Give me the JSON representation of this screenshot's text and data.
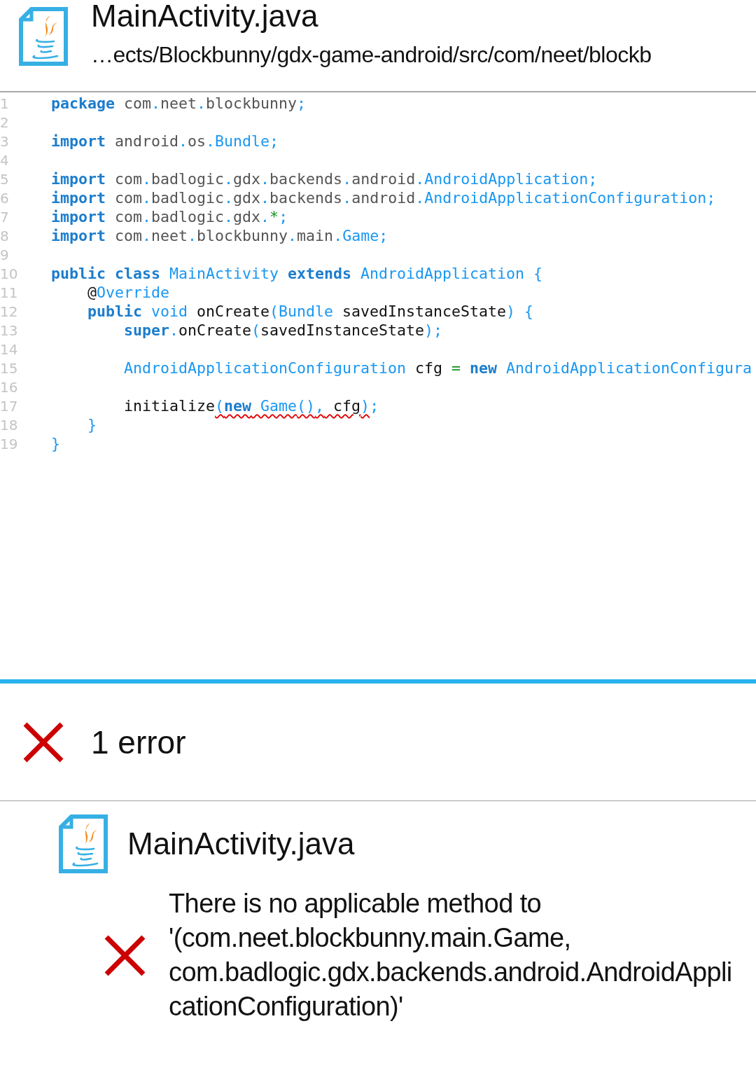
{
  "header": {
    "file_name": "MainActivity.java",
    "path": "…ects/Blockbunny/gdx-game-android/src/com/neet/blockb"
  },
  "editor": {
    "lines": [
      {
        "number": "1",
        "tokens": [
          {
            "text": "package",
            "kind": "keyword"
          },
          {
            "text": " com",
            "kind": "path"
          },
          {
            "text": ".",
            "kind": "punct"
          },
          {
            "text": "neet",
            "kind": "path"
          },
          {
            "text": ".",
            "kind": "punct"
          },
          {
            "text": "blockbunny",
            "kind": "path"
          },
          {
            "text": ";",
            "kind": "punct"
          }
        ]
      },
      {
        "number": "2"
      },
      {
        "number": "3",
        "tokens": [
          {
            "text": "import",
            "kind": "keyword"
          },
          {
            "text": " android",
            "kind": "path"
          },
          {
            "text": ".",
            "kind": "punct"
          },
          {
            "text": "os",
            "kind": "path"
          },
          {
            "text": ".",
            "kind": "punct"
          },
          {
            "text": "Bundle",
            "kind": "type"
          },
          {
            "text": ";",
            "kind": "punct"
          }
        ]
      },
      {
        "number": "4"
      },
      {
        "number": "5",
        "tokens": [
          {
            "text": "import",
            "kind": "keyword"
          },
          {
            "text": " com",
            "kind": "path"
          },
          {
            "text": ".",
            "kind": "punct"
          },
          {
            "text": "badlogic",
            "kind": "path"
          },
          {
            "text": ".",
            "kind": "punct"
          },
          {
            "text": "gdx",
            "kind": "path"
          },
          {
            "text": ".",
            "kind": "punct"
          },
          {
            "text": "backends",
            "kind": "path"
          },
          {
            "text": ".",
            "kind": "punct"
          },
          {
            "text": "android",
            "kind": "path"
          },
          {
            "text": ".",
            "kind": "punct"
          },
          {
            "text": "AndroidApplication",
            "kind": "type"
          },
          {
            "text": ";",
            "kind": "punct"
          }
        ]
      },
      {
        "number": "6",
        "tokens": [
          {
            "text": "import",
            "kind": "keyword"
          },
          {
            "text": " com",
            "kind": "path"
          },
          {
            "text": ".",
            "kind": "punct"
          },
          {
            "text": "badlogic",
            "kind": "path"
          },
          {
            "text": ".",
            "kind": "punct"
          },
          {
            "text": "gdx",
            "kind": "path"
          },
          {
            "text": ".",
            "kind": "punct"
          },
          {
            "text": "backends",
            "kind": "path"
          },
          {
            "text": ".",
            "kind": "punct"
          },
          {
            "text": "android",
            "kind": "path"
          },
          {
            "text": ".",
            "kind": "punct"
          },
          {
            "text": "AndroidApplicationConfiguration",
            "kind": "type"
          },
          {
            "text": ";",
            "kind": "punct"
          }
        ]
      },
      {
        "number": "7",
        "tokens": [
          {
            "text": "import",
            "kind": "keyword"
          },
          {
            "text": " com",
            "kind": "path"
          },
          {
            "text": ".",
            "kind": "punct"
          },
          {
            "text": "badlogic",
            "kind": "path"
          },
          {
            "text": ".",
            "kind": "punct"
          },
          {
            "text": "gdx",
            "kind": "path"
          },
          {
            "text": ".",
            "kind": "punct"
          },
          {
            "text": "*",
            "kind": "operator"
          },
          {
            "text": ";",
            "kind": "punct"
          }
        ]
      },
      {
        "number": "8",
        "tokens": [
          {
            "text": "import",
            "kind": "keyword"
          },
          {
            "text": " com",
            "kind": "path"
          },
          {
            "text": ".",
            "kind": "punct"
          },
          {
            "text": "neet",
            "kind": "path"
          },
          {
            "text": ".",
            "kind": "punct"
          },
          {
            "text": "blockbunny",
            "kind": "path"
          },
          {
            "text": ".",
            "kind": "punct"
          },
          {
            "text": "main",
            "kind": "path"
          },
          {
            "text": ".",
            "kind": "punct"
          },
          {
            "text": "Game",
            "kind": "type"
          },
          {
            "text": ";",
            "kind": "punct"
          }
        ]
      },
      {
        "number": "9"
      },
      {
        "number": "10",
        "tokens": [
          {
            "text": "public",
            "kind": "keyword"
          },
          {
            "text": " class",
            "kind": "keyword"
          },
          {
            "text": " MainActivity",
            "kind": "type"
          },
          {
            "text": " extends",
            "kind": "keyword"
          },
          {
            "text": " AndroidApplication",
            "kind": "type"
          },
          {
            "text": " {",
            "kind": "punct"
          }
        ]
      },
      {
        "number": "11",
        "tokens": [
          {
            "text": "    @",
            "kind": "name"
          },
          {
            "text": "Override",
            "kind": "type"
          }
        ]
      },
      {
        "number": "12",
        "tokens": [
          {
            "text": "    public",
            "kind": "keyword"
          },
          {
            "text": " void",
            "kind": "type"
          },
          {
            "text": " onCreate",
            "kind": "name"
          },
          {
            "text": "(",
            "kind": "punct"
          },
          {
            "text": "Bundle",
            "kind": "type"
          },
          {
            "text": " savedInstanceState",
            "kind": "name"
          },
          {
            "text": ")",
            "kind": "punct"
          },
          {
            "text": " {",
            "kind": "punct"
          }
        ]
      },
      {
        "number": "13",
        "tokens": [
          {
            "text": "        super",
            "kind": "keyword"
          },
          {
            "text": ".",
            "kind": "punct"
          },
          {
            "text": "onCreate",
            "kind": "name"
          },
          {
            "text": "(",
            "kind": "punct"
          },
          {
            "text": "savedInstanceState",
            "kind": "name"
          },
          {
            "text": ");",
            "kind": "punct"
          }
        ]
      },
      {
        "number": "14"
      },
      {
        "number": "15",
        "tokens": [
          {
            "text": "        AndroidApplicationConfiguration",
            "kind": "type"
          },
          {
            "text": " cfg",
            "kind": "name"
          },
          {
            "text": " =",
            "kind": "operator"
          },
          {
            "text": " new",
            "kind": "keyword"
          },
          {
            "text": " AndroidApplicationConfigura",
            "kind": "type"
          }
        ]
      },
      {
        "number": "16"
      },
      {
        "number": "17",
        "tokens": [
          {
            "text": "        initialize",
            "kind": "name"
          },
          {
            "kind": "error_span",
            "tokens": [
              {
                "text": "(",
                "kind": "punct"
              },
              {
                "text": "new",
                "kind": "keyword"
              },
              {
                "text": " Game",
                "kind": "type"
              },
              {
                "text": "()",
                "kind": "punct"
              },
              {
                "text": ",",
                "kind": "punct"
              },
              {
                "text": " cfg",
                "kind": "name"
              },
              {
                "text": ")",
                "kind": "punct"
              }
            ]
          },
          {
            "text": ";",
            "kind": "punct"
          }
        ]
      },
      {
        "number": "18",
        "tokens": [
          {
            "text": "    }",
            "kind": "punct"
          }
        ]
      },
      {
        "number": "19",
        "tokens": [
          {
            "text": "}",
            "kind": "punct"
          }
        ]
      }
    ]
  },
  "problems": {
    "summary": {
      "kind": "error",
      "text": "1 error"
    },
    "files": [
      {
        "file_name": "MainActivity.java",
        "messages": [
          {
            "kind": "error",
            "text": "There is no applicable method to '(com.neet.blockbunny.main.Game, com.badlogic.gdx.backends.android.AndroidApplicationConfiguration)'"
          }
        ]
      }
    ]
  }
}
